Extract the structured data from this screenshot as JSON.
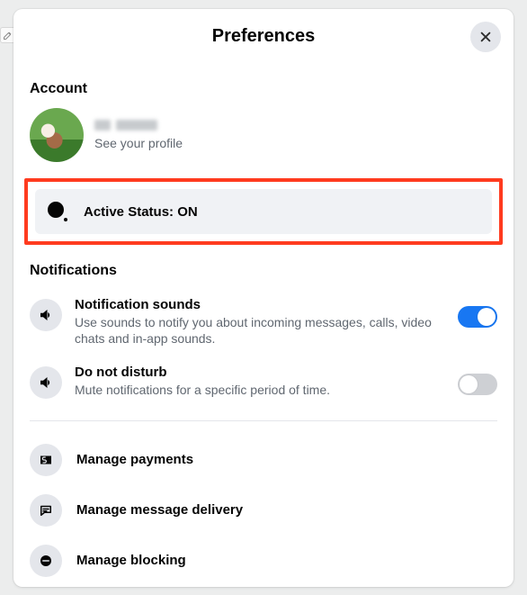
{
  "header": {
    "title": "Preferences"
  },
  "account": {
    "section_label": "Account",
    "profile_subtext": "See your profile"
  },
  "active_status": {
    "label": "Active Status: ON"
  },
  "notifications": {
    "section_label": "Notifications",
    "sounds": {
      "title": "Notification sounds",
      "subtitle": "Use sounds to notify you about incoming messages, calls, video chats and in-app sounds.",
      "enabled": true
    },
    "dnd": {
      "title": "Do not disturb",
      "subtitle": "Mute notifications for a specific period of time.",
      "enabled": false
    }
  },
  "manage": {
    "payments": "Manage payments",
    "delivery": "Manage message delivery",
    "blocking": "Manage blocking"
  }
}
